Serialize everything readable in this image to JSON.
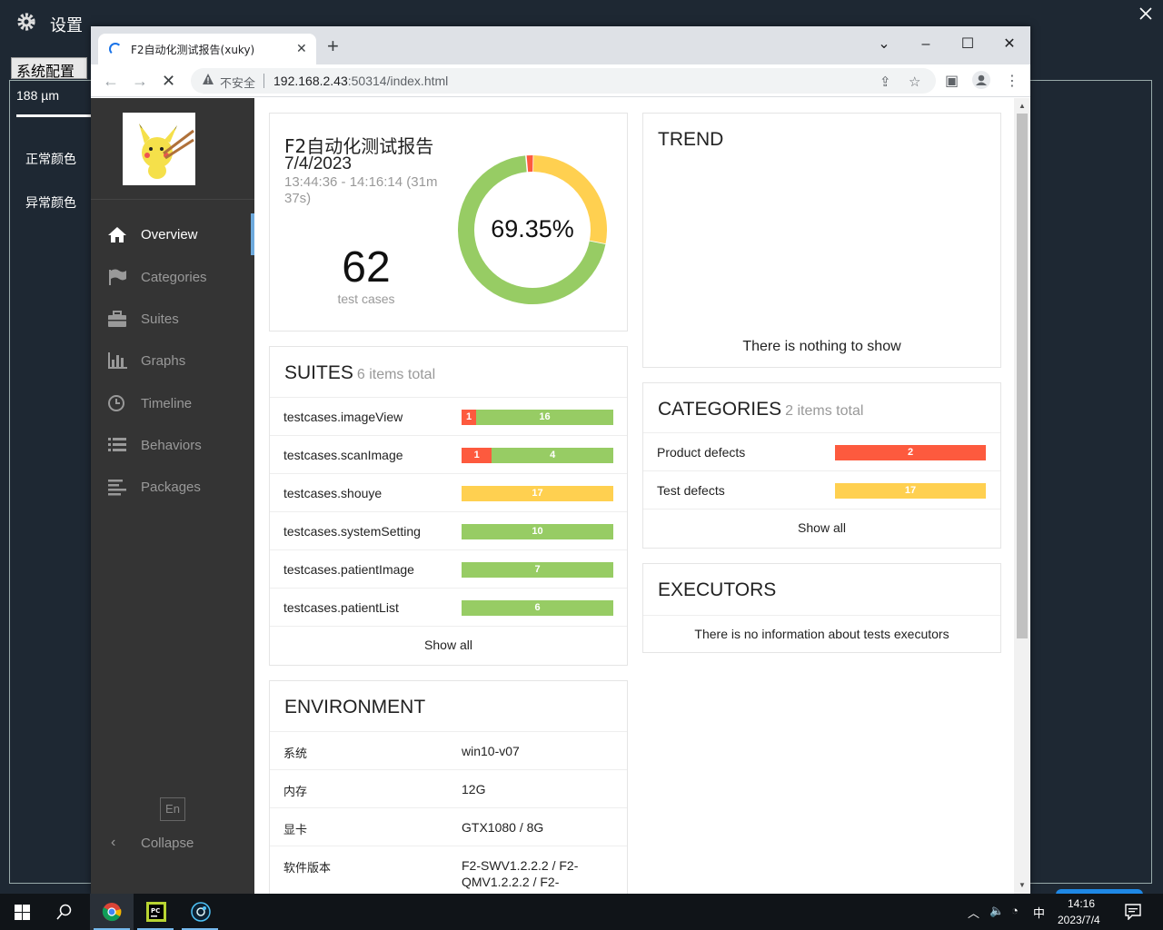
{
  "background_app": {
    "title": "设置",
    "tab": "系统配置",
    "size_value": "188 µm",
    "normal_color_label": "正常颜色",
    "error_color_label": "异常颜色"
  },
  "browser": {
    "tab_title": "F2自动化测试报告(xuky)",
    "security_label": "不安全",
    "url_host": "192.168.2.43",
    "url_rest": ":50314/index.html"
  },
  "sidebar": {
    "items": [
      {
        "label": "Overview",
        "icon": "home-icon",
        "active": true
      },
      {
        "label": "Categories",
        "icon": "flag-icon"
      },
      {
        "label": "Suites",
        "icon": "briefcase-icon"
      },
      {
        "label": "Graphs",
        "icon": "bar-chart-icon"
      },
      {
        "label": "Timeline",
        "icon": "clock-icon"
      },
      {
        "label": "Behaviors",
        "icon": "list-icon"
      },
      {
        "label": "Packages",
        "icon": "align-left-icon"
      }
    ],
    "lang": "En",
    "collapse": "Collapse"
  },
  "summary": {
    "title": "F2自动化测试报告",
    "date": "7/4/2023",
    "time_range": "13:44:36 - 14:16:14 (31m 37s)",
    "test_count": "62",
    "test_count_label": "test cases",
    "percent": "69.35%",
    "donut": {
      "failed": 1,
      "broken": 17,
      "passed": 43
    },
    "colors": {
      "failed": "#fd5a3e",
      "broken": "#ffd050",
      "passed": "#97cc64"
    }
  },
  "trend": {
    "title": "TREND",
    "empty": "There is nothing to show"
  },
  "suites": {
    "title": "SUITES",
    "count": "6 items total",
    "rows": [
      {
        "name": "testcases.imageView",
        "segments": [
          {
            "type": "red",
            "value": "1"
          },
          {
            "type": "green",
            "value": "16"
          }
        ]
      },
      {
        "name": "testcases.scanImage",
        "segments": [
          {
            "type": "red",
            "value": "1"
          },
          {
            "type": "green",
            "value": "4"
          }
        ]
      },
      {
        "name": "testcases.shouye",
        "segments": [
          {
            "type": "yellow",
            "value": "17"
          }
        ]
      },
      {
        "name": "testcases.systemSetting",
        "segments": [
          {
            "type": "green",
            "value": "10"
          }
        ]
      },
      {
        "name": "testcases.patientImage",
        "segments": [
          {
            "type": "green",
            "value": "7"
          }
        ]
      },
      {
        "name": "testcases.patientList",
        "segments": [
          {
            "type": "green",
            "value": "6"
          }
        ]
      }
    ],
    "show_all": "Show all"
  },
  "categories": {
    "title": "CATEGORIES",
    "count": "2 items total",
    "rows": [
      {
        "name": "Product defects",
        "segments": [
          {
            "type": "red",
            "value": "2"
          }
        ]
      },
      {
        "name": "Test defects",
        "segments": [
          {
            "type": "yellow",
            "value": "17"
          }
        ]
      }
    ],
    "show_all": "Show all"
  },
  "executors": {
    "title": "EXECUTORS",
    "empty": "There is no information about tests executors"
  },
  "environment": {
    "title": "ENVIRONMENT",
    "rows": [
      {
        "key": "系统",
        "value": "win10-v07"
      },
      {
        "key": "内存",
        "value": "12G"
      },
      {
        "key": "显卡",
        "value": "GTX1080 / 8G"
      },
      {
        "key": "软件版本",
        "value": "F2-SWV1.2.2.2 / F2-QMV1.2.2.2 / F2-"
      }
    ]
  },
  "taskbar": {
    "time": "14:16",
    "date": "2023/7/4",
    "ime": "中"
  }
}
